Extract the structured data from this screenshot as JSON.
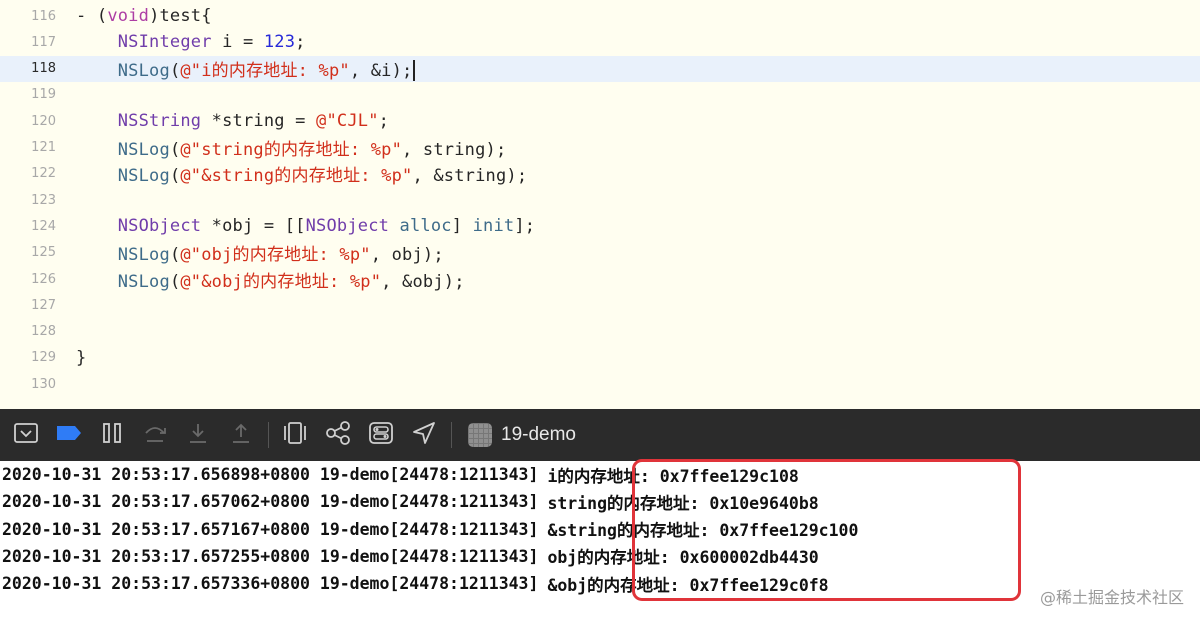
{
  "editor": {
    "lines": [
      {
        "num": "116",
        "tokens": [
          [
            "pl",
            "- ("
          ],
          [
            "kw",
            "void"
          ],
          [
            "pl",
            ")test{"
          ]
        ]
      },
      {
        "num": "117",
        "tokens": [
          [
            "pl",
            "    "
          ],
          [
            "ty",
            "NSInteger"
          ],
          [
            "pl",
            " i = "
          ],
          [
            "num",
            "123"
          ],
          [
            "pl",
            ";"
          ]
        ]
      },
      {
        "num": "118",
        "current": true,
        "tokens": [
          [
            "pl",
            "    "
          ],
          [
            "fn",
            "NSLog"
          ],
          [
            "pl",
            "("
          ],
          [
            "str",
            "@\"i的内存地址: %p\""
          ],
          [
            "pl",
            ", &i);"
          ]
        ]
      },
      {
        "num": "119",
        "tokens": []
      },
      {
        "num": "120",
        "tokens": [
          [
            "pl",
            "    "
          ],
          [
            "ty",
            "NSString"
          ],
          [
            "pl",
            " *string = "
          ],
          [
            "str",
            "@\"CJL\""
          ],
          [
            "pl",
            ";"
          ]
        ]
      },
      {
        "num": "121",
        "tokens": [
          [
            "pl",
            "    "
          ],
          [
            "fn",
            "NSLog"
          ],
          [
            "pl",
            "("
          ],
          [
            "str",
            "@\"string的内存地址: %p\""
          ],
          [
            "pl",
            ", string);"
          ]
        ]
      },
      {
        "num": "122",
        "tokens": [
          [
            "pl",
            "    "
          ],
          [
            "fn",
            "NSLog"
          ],
          [
            "pl",
            "("
          ],
          [
            "str",
            "@\"&string的内存地址: %p\""
          ],
          [
            "pl",
            ", &string);"
          ]
        ]
      },
      {
        "num": "123",
        "tokens": []
      },
      {
        "num": "124",
        "tokens": [
          [
            "pl",
            "    "
          ],
          [
            "ty",
            "NSObject"
          ],
          [
            "pl",
            " *obj = [["
          ],
          [
            "ty",
            "NSObject"
          ],
          [
            "pl",
            " "
          ],
          [
            "fn",
            "alloc"
          ],
          [
            "pl",
            "] "
          ],
          [
            "fn",
            "init"
          ],
          [
            "pl",
            "];"
          ]
        ]
      },
      {
        "num": "125",
        "tokens": [
          [
            "pl",
            "    "
          ],
          [
            "fn",
            "NSLog"
          ],
          [
            "pl",
            "("
          ],
          [
            "str",
            "@\"obj的内存地址: %p\""
          ],
          [
            "pl",
            ", obj);"
          ]
        ]
      },
      {
        "num": "126",
        "tokens": [
          [
            "pl",
            "    "
          ],
          [
            "fn",
            "NSLog"
          ],
          [
            "pl",
            "("
          ],
          [
            "str",
            "@\"&obj的内存地址: %p\""
          ],
          [
            "pl",
            ", &obj);"
          ]
        ]
      },
      {
        "num": "127",
        "tokens": []
      },
      {
        "num": "128",
        "tokens": []
      },
      {
        "num": "129",
        "tokens": [
          [
            "pl",
            "}"
          ]
        ]
      },
      {
        "num": "130",
        "tokens": []
      }
    ]
  },
  "debug_bar": {
    "buttons": [
      {
        "name": "hide-debug-area-icon",
        "icon": "tray-down"
      },
      {
        "name": "breakpoints-toggle-icon",
        "icon": "breakpoint-tag"
      },
      {
        "name": "pause-icon",
        "icon": "pause"
      },
      {
        "name": "step-over-icon",
        "icon": "step-over"
      },
      {
        "name": "step-into-icon",
        "icon": "step-into"
      },
      {
        "name": "step-out-icon",
        "icon": "step-out"
      },
      {
        "name": "view-debugger-icon",
        "icon": "view-hierarchy"
      },
      {
        "name": "memory-graph-icon",
        "icon": "memory-graph"
      },
      {
        "name": "environment-overrides-icon",
        "icon": "env-overrides"
      },
      {
        "name": "simulate-location-icon",
        "icon": "location-arrow"
      }
    ],
    "target_name": "19-demo",
    "colors": {
      "background": "#2b2b2b",
      "accent": "#2f7cf6",
      "icon": "#d0d0d0",
      "icon_disabled": "#6a6a6a"
    }
  },
  "console": {
    "lines": [
      {
        "prefix": "2020-10-31 20:53:17.656898+0800 19-demo[24478:1211343]",
        "message": "i的内存地址: 0x7ffee129c108"
      },
      {
        "prefix": "2020-10-31 20:53:17.657062+0800 19-demo[24478:1211343]",
        "message": "string的内存地址: 0x10e9640b8"
      },
      {
        "prefix": "2020-10-31 20:53:17.657167+0800 19-demo[24478:1211343]",
        "message": "&string的内存地址: 0x7ffee129c100"
      },
      {
        "prefix": "2020-10-31 20:53:17.657255+0800 19-demo[24478:1211343]",
        "message": "obj的内存地址: 0x600002db4430"
      },
      {
        "prefix": "2020-10-31 20:53:17.657336+0800 19-demo[24478:1211343]",
        "message": "&obj的内存地址: 0x7ffee129c0f8"
      }
    ],
    "highlight_color": "#e0343a"
  },
  "watermark": "@稀土掘金技术社区"
}
